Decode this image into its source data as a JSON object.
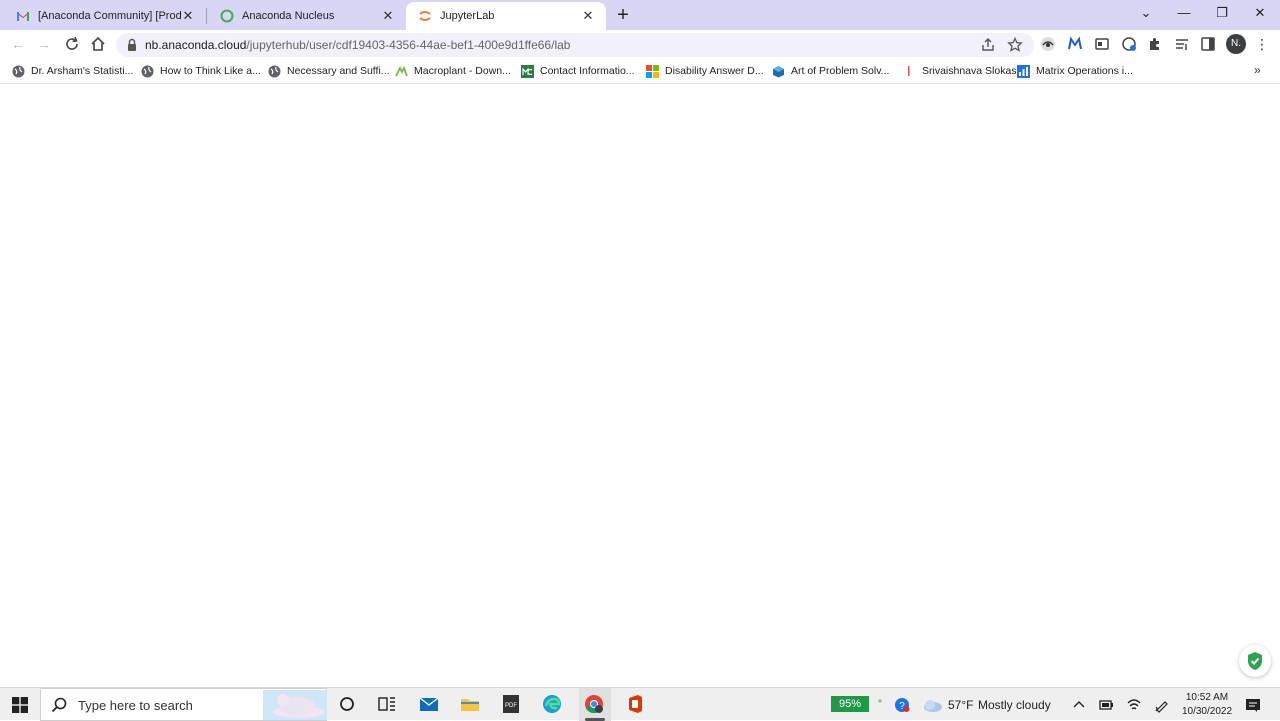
{
  "browser": {
    "tabs": [
      {
        "title": "[Anaconda Community] [Product",
        "icon": "gmail-icon",
        "active": false
      },
      {
        "title": "Anaconda Nucleus",
        "icon": "anaconda-icon",
        "active": false
      },
      {
        "title": "JupyterLab",
        "icon": "jupyter-icon",
        "active": true
      }
    ],
    "address": {
      "host": "nb.anaconda.cloud",
      "path": "/jupyterhub/user/cdf19403-4356-44ae-bef1-400e9d1ffe66/lab"
    },
    "profile_initial": "N.",
    "bookmarks": [
      {
        "label": "Dr. Arsham's Statisti...",
        "icon": "globe-icon"
      },
      {
        "label": "How to Think Like a...",
        "icon": "globe-icon"
      },
      {
        "label": "Necessary and Suffi...",
        "icon": "globe-icon"
      },
      {
        "label": "Macroplant - Down...",
        "icon": "macroplant-icon"
      },
      {
        "label": "Contact Informatio...",
        "icon": "mc-icon"
      },
      {
        "label": "Disability Answer D...",
        "icon": "microsoft-icon"
      },
      {
        "label": "Art of Problem Solv...",
        "icon": "aops-icon"
      },
      {
        "label": "Srivaishnava Slokas",
        "icon": "flag-icon"
      },
      {
        "label": "Matrix Operations i...",
        "icon": "chart-icon"
      }
    ],
    "bookmarks_more": "»"
  },
  "taskbar": {
    "search_placeholder": "Type here to search",
    "battery": "95%",
    "weather_temp": "57°F",
    "weather_desc": "Mostly cloudy",
    "time": "10:52 AM",
    "date": "10/30/2022"
  },
  "colors": {
    "tabbar": "#d9d5f5",
    "omnibox": "#f1f0fb",
    "battery": "#1e9a46",
    "shield": "#2ea44f"
  }
}
